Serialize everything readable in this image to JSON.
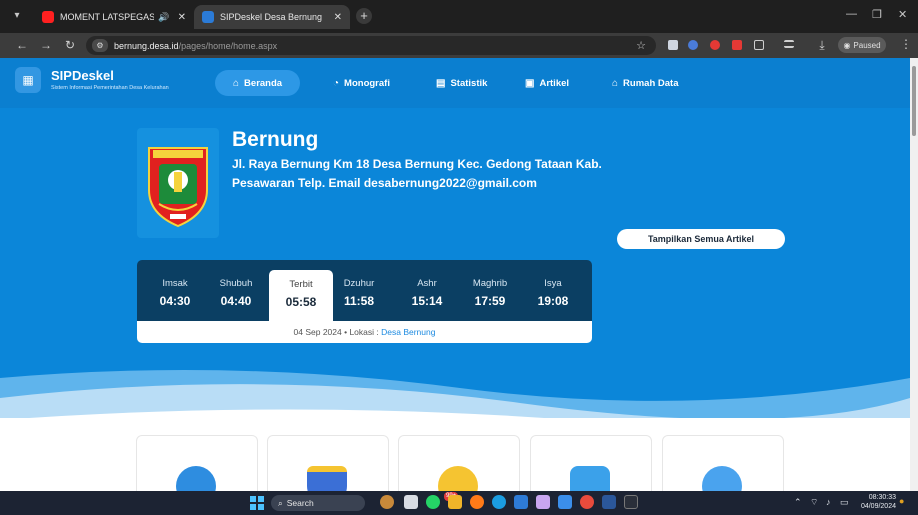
{
  "browser": {
    "tabs": [
      {
        "title": "MOMENT LATSPEGAS SYIL",
        "audio": "🔊",
        "active": false
      },
      {
        "title": "SIPDeskel Desa Bernung",
        "active": true
      }
    ],
    "url_domain": "bernung.desa.id",
    "url_path": "/pages/home/home.aspx",
    "profile_status": "Paused"
  },
  "site": {
    "brand_name": "SIPDeskel",
    "brand_tagline": "Sistem Informasi Pemerintahan Desa Kelurahan",
    "nav": [
      {
        "label": "Beranda",
        "icon": "home-icon",
        "active": true
      },
      {
        "label": "Monografi",
        "icon": "chart-pie-icon",
        "active": false
      },
      {
        "label": "Statistik",
        "icon": "bar-chart-icon",
        "active": false
      },
      {
        "label": "Artikel",
        "icon": "newspaper-icon",
        "active": false
      },
      {
        "label": "Rumah Data",
        "icon": "people-house-icon",
        "active": false
      }
    ]
  },
  "village": {
    "name": "Bernung",
    "address": "Jl. Raya Bernung Km 18 Desa Bernung Kec. Gedong Tataan Kab. Pesawaran Telp. Email desabernung2022@gmail.com",
    "all_articles_button": "Tampilkan Semua Artikel"
  },
  "prayer": {
    "times": [
      {
        "name": "Imsak",
        "time": "04:30"
      },
      {
        "name": "Shubuh",
        "time": "04:40"
      },
      {
        "name": "Terbit",
        "time": "05:58",
        "active": true
      },
      {
        "name": "Dzuhur",
        "time": "11:58"
      },
      {
        "name": "Ashr",
        "time": "15:14"
      },
      {
        "name": "Maghrib",
        "time": "17:59"
      },
      {
        "name": "Isya",
        "time": "19:08"
      }
    ],
    "date": "04 Sep 2024",
    "location_label": "Lokasi :",
    "location": "Desa Bernung"
  },
  "taskbar": {
    "search_placeholder": "Search",
    "whatsapp_badge": "99+",
    "clock_time": "08:30:33",
    "clock_date": "04/09/2024"
  },
  "colors": {
    "page_blue": "#0b86d9",
    "prayer_panel": "#0b3f63",
    "link_blue": "#1c8ae0"
  }
}
